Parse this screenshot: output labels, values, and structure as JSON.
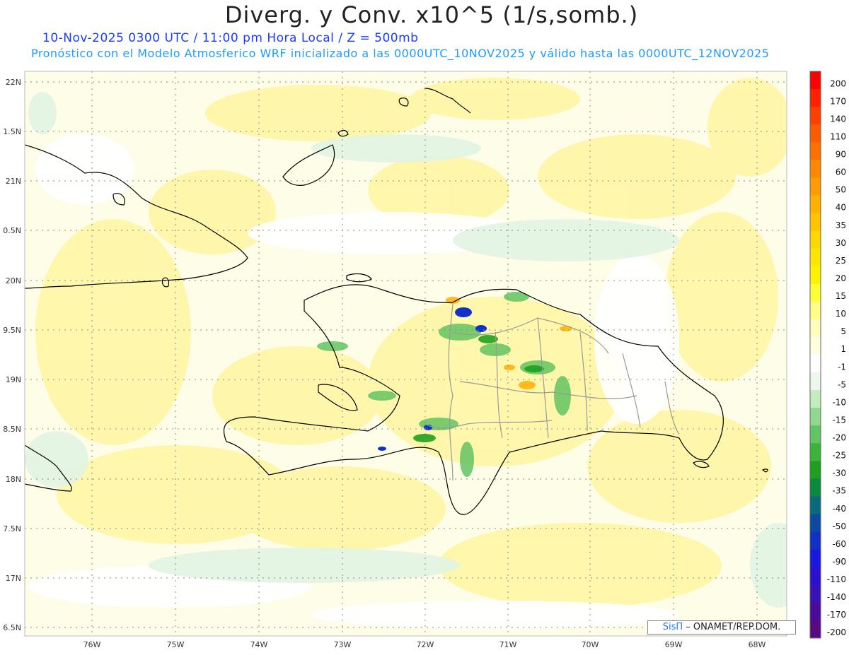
{
  "title": "Diverg. y Conv. x10^5 (1/s,somb.)",
  "subtitle_line1": "10-Nov-2025  0300 UTC / 11:00 pm Hora Local / Z = 500mb",
  "subtitle_line2": "Pronóstico con el Modelo Atmosferico WRF inicializado a las 0000UTC_10NOV2025 y válido hasta las  0000UTC_12NOV2025",
  "y_axis_labels": [
    "22N",
    "1.5N",
    "21N",
    "0.5N",
    "20N",
    "9.5N",
    "19N",
    "8.5N",
    "18N",
    "7.5N",
    "17N",
    "6.5N"
  ],
  "x_axis_labels": [
    "76W",
    "75W",
    "74W",
    "73W",
    "72W",
    "71W",
    "70W",
    "69W",
    "68W"
  ],
  "colorbar": {
    "labels": [
      "200",
      "170",
      "140",
      "110",
      "90",
      "60",
      "50",
      "40",
      "35",
      "30",
      "25",
      "20",
      "15",
      "10",
      "5",
      "1",
      "-1",
      "-5",
      "-10",
      "-15",
      "-20",
      "-25",
      "-30",
      "-35",
      "-40",
      "-50",
      "-60",
      "-90",
      "-110",
      "-140",
      "-170",
      "-200"
    ],
    "colors": [
      "#ff0000",
      "#ff2000",
      "#ff4000",
      "#ff5a00",
      "#ff7000",
      "#ff8800",
      "#ff9c00",
      "#ffb000",
      "#ffc400",
      "#ffd800",
      "#ffe600",
      "#fff200",
      "#ffff33",
      "#ffff88",
      "#ffffbb",
      "#ffffe0",
      "#ffffff",
      "#ecf8ec",
      "#c2ecc2",
      "#90d890",
      "#62c462",
      "#3cb43c",
      "#1ea01e",
      "#0a8a3c",
      "#086a7a",
      "#0a4aa0",
      "#1030c8",
      "#1818e0",
      "#2a10d0",
      "#3a10b8",
      "#4a0c98",
      "#5a0a80"
    ]
  },
  "credit": {
    "brand": "SisΠ",
    "text": " – ONAMET/REP.DOM."
  },
  "colors": {
    "title": "#222222",
    "subtitle_line1": "#1a3cff",
    "subtitle_line2": "#1e9bff",
    "background_field": "#ffffcc",
    "convergence": "#3cb43c",
    "coast": "#000000",
    "provinces": "#999999"
  }
}
